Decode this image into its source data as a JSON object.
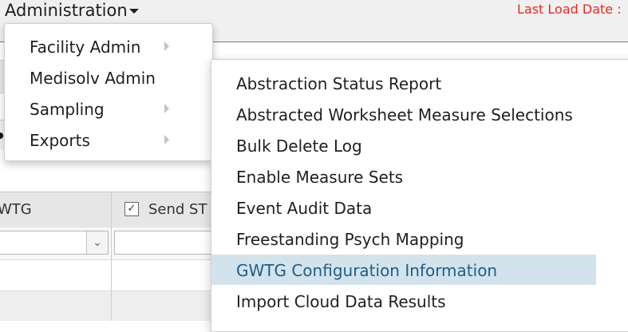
{
  "header": {
    "menu_label": "Administration",
    "last_load_label": "Last Load Date :"
  },
  "dropdown": {
    "items": [
      {
        "label": "Facility Admin",
        "has_submenu": true
      },
      {
        "label": "Medisolv Admin",
        "has_submenu": false
      },
      {
        "label": "Sampling",
        "has_submenu": true
      },
      {
        "label": "Exports",
        "has_submenu": true
      }
    ]
  },
  "submenu": {
    "items": [
      {
        "label": "Abstraction Status Report"
      },
      {
        "label": "Abstracted Worksheet Measure Selections"
      },
      {
        "label": "Bulk Delete Log"
      },
      {
        "label": "Enable Measure Sets"
      },
      {
        "label": "Event Audit Data"
      },
      {
        "label": "Freestanding Psych Mapping"
      },
      {
        "label": "GWTG Configuration Information",
        "active": true
      },
      {
        "label": "Import Cloud Data Results"
      }
    ]
  },
  "grid": {
    "col1_header": "WTG",
    "col2_header": "Send ST",
    "col2_checked": true
  },
  "colors": {
    "accent_red": "#e8291f",
    "highlight_bg": "#d3e3ec",
    "highlight_text": "#1f5d86"
  }
}
